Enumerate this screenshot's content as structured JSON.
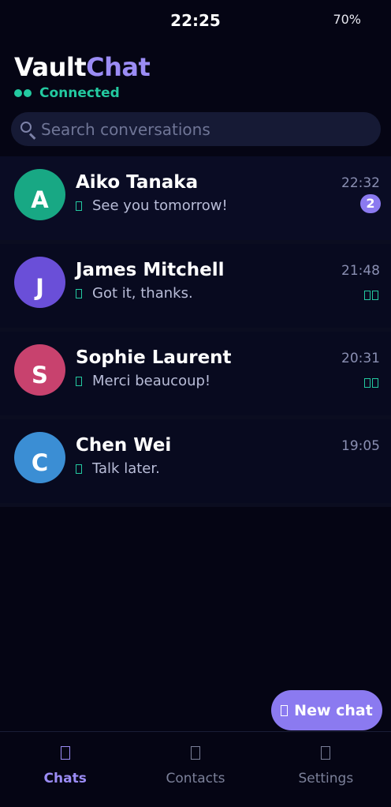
{
  "status_bar": {
    "time": "22:25",
    "battery": "70%"
  },
  "header": {
    "brand_part1": "Vault",
    "brand_part2": "Chat",
    "connection_status": "Connected",
    "accent": "#9b8cf5",
    "status_color": "#23c9a0"
  },
  "search": {
    "placeholder": "Search conversations",
    "value": ""
  },
  "chats": [
    {
      "initial": "A",
      "name": "Aiko Tanaka",
      "preview": "See you tomorrow!",
      "time": "22:32",
      "unread": "2",
      "avatar_color": "#18a884"
    },
    {
      "initial": "J",
      "name": "James Mitchell",
      "preview": "Got it, thanks.",
      "time": "21:48",
      "unread": "",
      "avatar_color": "#6a4fd8"
    },
    {
      "initial": "S",
      "name": "Sophie Laurent",
      "preview": "Merci beaucoup!",
      "time": "20:31",
      "unread": "",
      "avatar_color": "#c8426e"
    },
    {
      "initial": "C",
      "name": "Chen Wei",
      "preview": "Talk later.",
      "time": "19:05",
      "unread": "",
      "avatar_color": "#3b8ed4"
    }
  ],
  "fab": {
    "label": "New chat",
    "icon": "compose-icon"
  },
  "nav": {
    "items": [
      {
        "label": "Chats",
        "icon": "chat-icon",
        "active": true
      },
      {
        "label": "Contacts",
        "icon": "contacts-icon",
        "active": false
      },
      {
        "label": "Settings",
        "icon": "settings-icon",
        "active": false
      }
    ]
  }
}
